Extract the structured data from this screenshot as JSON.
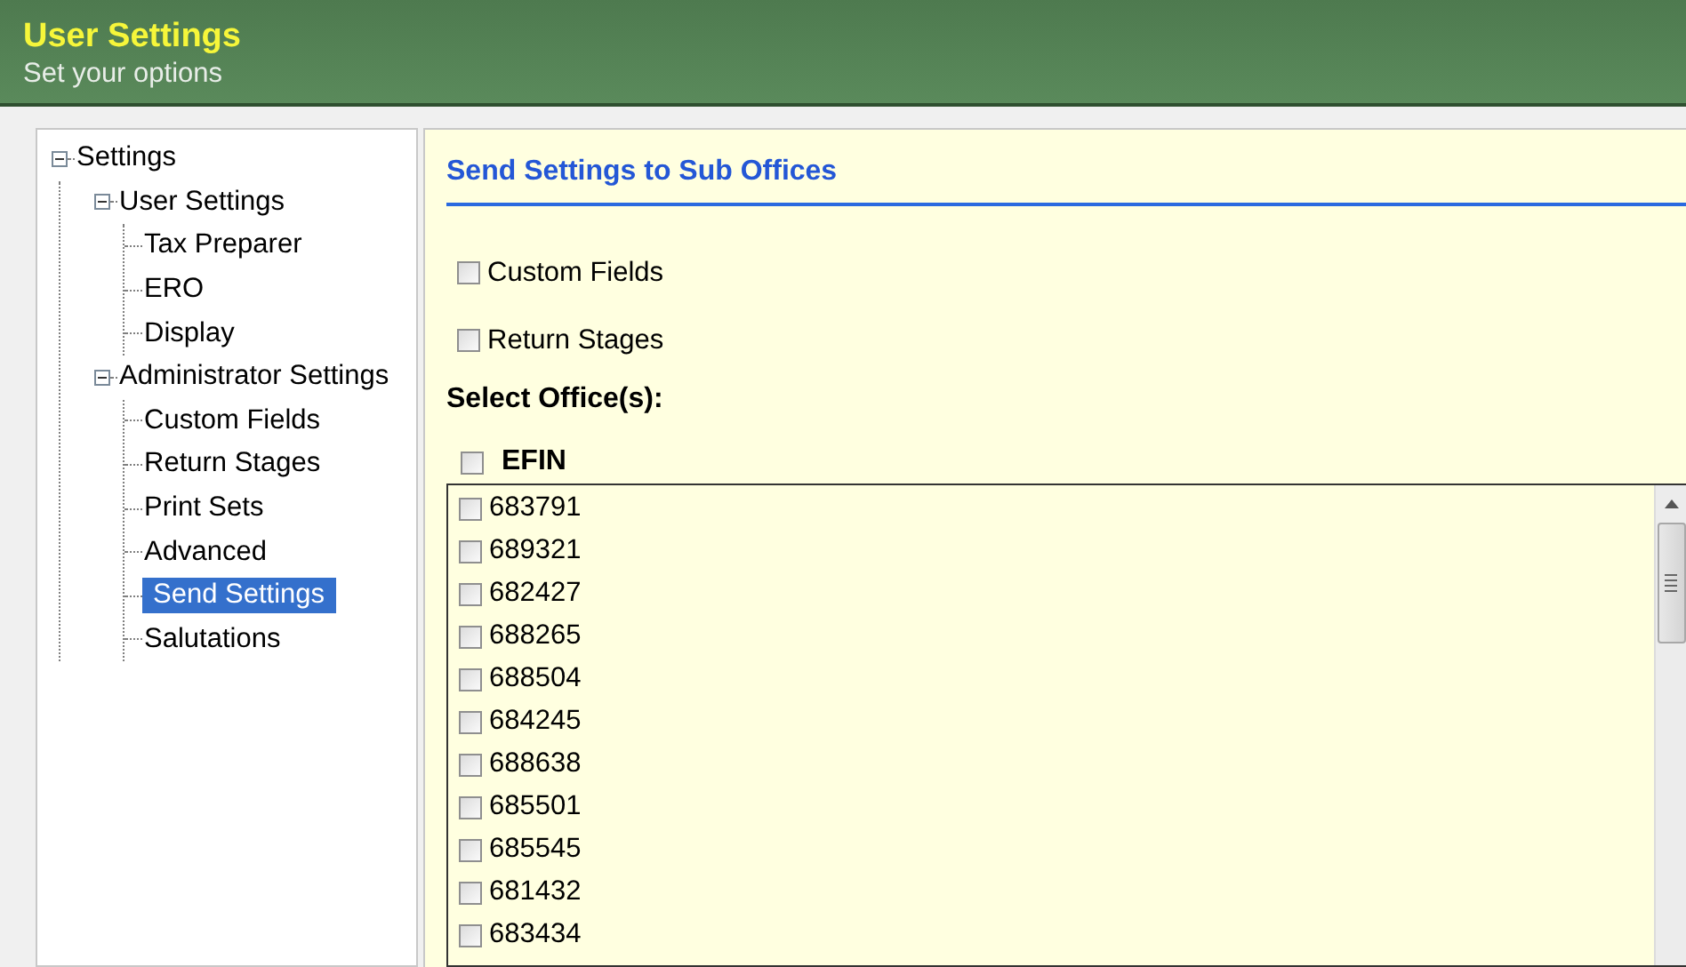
{
  "header": {
    "title": "User Settings",
    "subtitle": "Set your options"
  },
  "tree": [
    {
      "label": "Settings",
      "expanded": true,
      "selected": false,
      "children": [
        {
          "label": "User Settings",
          "expanded": true,
          "selected": false,
          "children": [
            {
              "label": "Tax Preparer",
              "selected": false
            },
            {
              "label": "ERO",
              "selected": false
            },
            {
              "label": "Display",
              "selected": false
            }
          ]
        },
        {
          "label": "Administrator Settings",
          "expanded": true,
          "selected": false,
          "children": [
            {
              "label": "Custom Fields",
              "selected": false
            },
            {
              "label": "Return Stages",
              "selected": false
            },
            {
              "label": "Print Sets",
              "selected": false
            },
            {
              "label": "Advanced",
              "selected": false
            },
            {
              "label": "Send Settings",
              "selected": true
            },
            {
              "label": "Salutations",
              "selected": false
            }
          ]
        }
      ]
    }
  ],
  "panel": {
    "title": "Send Settings to Sub Offices",
    "options": [
      {
        "label": "Custom Fields",
        "checked": false
      },
      {
        "label": "Return Stages",
        "checked": false
      }
    ],
    "select_label": "Select Office(s):",
    "list_header": {
      "label": "EFIN",
      "checked": false
    },
    "offices": [
      {
        "efin": "683791",
        "checked": false
      },
      {
        "efin": "689321",
        "checked": false
      },
      {
        "efin": "682427",
        "checked": false
      },
      {
        "efin": "688265",
        "checked": false
      },
      {
        "efin": "688504",
        "checked": false
      },
      {
        "efin": "684245",
        "checked": false
      },
      {
        "efin": "688638",
        "checked": false
      },
      {
        "efin": "685501",
        "checked": false
      },
      {
        "efin": "685545",
        "checked": false
      },
      {
        "efin": "681432",
        "checked": false
      },
      {
        "efin": "683434",
        "checked": false
      }
    ]
  }
}
